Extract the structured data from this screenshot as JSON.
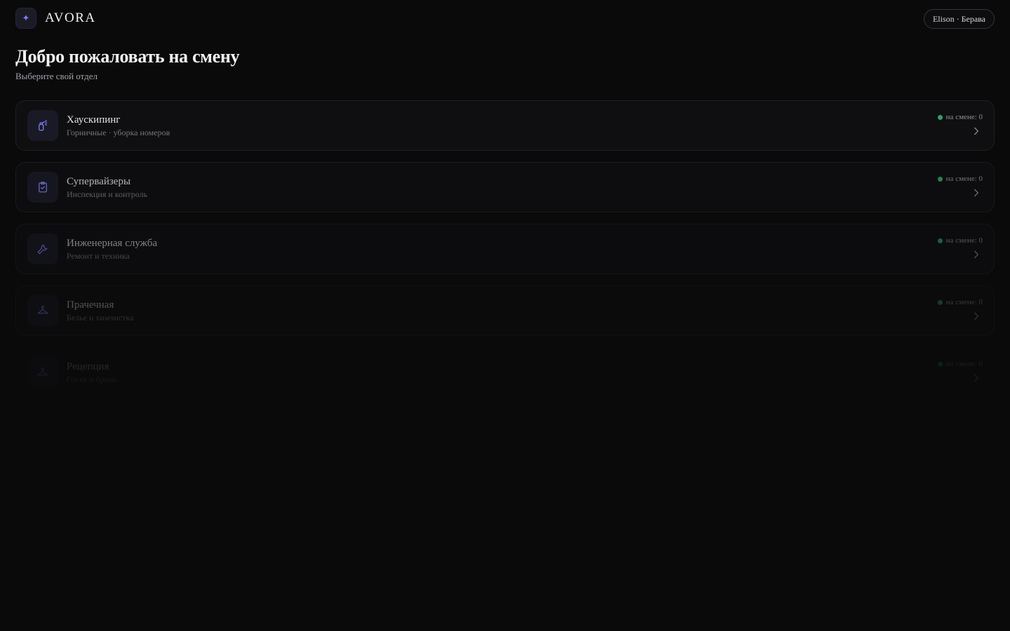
{
  "header": {
    "logo_glyph": "✦",
    "brand": "AVORA",
    "user": "Elison · Берава"
  },
  "page": {
    "title": "Добро пожаловать на смену",
    "subtitle": "Выберите свой отдел"
  },
  "status_color": "#2fa36b",
  "accent_color": "#7b7ef0",
  "departments": [
    {
      "name": "Хаускипинг",
      "desc": "Горничные · уборка номеров",
      "status": "на смене: 0",
      "icon": "spray-bottle-icon"
    },
    {
      "name": "Супервайзеры",
      "desc": "Инспекция и контроль",
      "status": "на смене: 0",
      "icon": "clipboard-check-icon"
    },
    {
      "name": "Инженерная служба",
      "desc": "Ремонт и техника",
      "status": "на смене: 0",
      "icon": "wrench-icon"
    },
    {
      "name": "Прачечная",
      "desc": "Белье и химчистка",
      "status": "на смене: 0",
      "icon": "hanger-icon"
    },
    {
      "name": "Рецепция",
      "desc": "Гости и бронь",
      "status": "на смене: 0",
      "icon": "bell-icon"
    }
  ]
}
